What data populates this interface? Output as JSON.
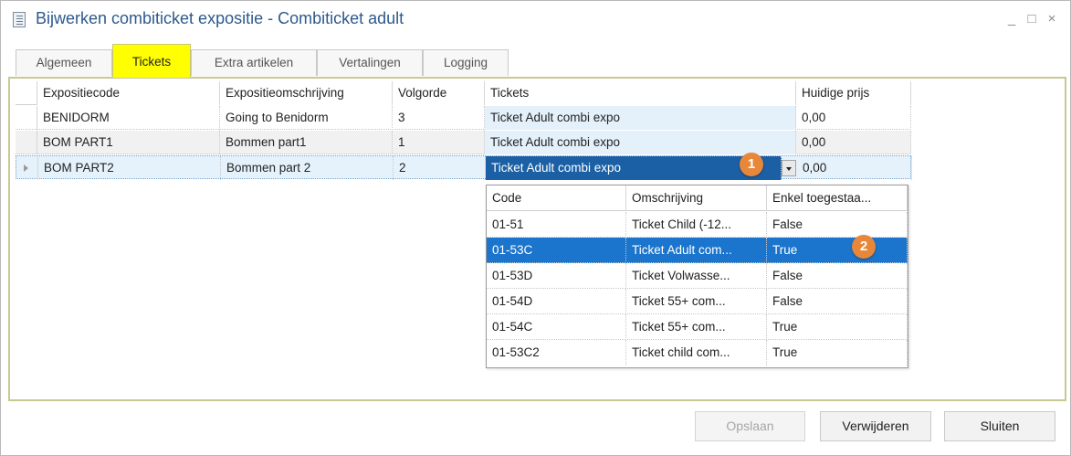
{
  "window": {
    "title": "Bijwerken combiticket expositie  - Combiticket adult",
    "controls": {
      "minimize": "_",
      "maximize": "□",
      "close": "×"
    }
  },
  "tabs": [
    "Algemeen",
    "Tickets",
    "Extra artikelen",
    "Vertalingen",
    "Logging"
  ],
  "active_tab": "Tickets",
  "grid": {
    "headers": [
      "Expositiecode",
      "Expositieomschrijving",
      "Volgorde",
      "Tickets",
      "Huidige prijs"
    ],
    "rows": [
      [
        "BENIDORM",
        "Going to Benidorm",
        "3",
        "Ticket Adult combi expo",
        "0,00"
      ],
      [
        "BOM PART1",
        "Bommen part1",
        "1",
        "Ticket Adult combi expo",
        "0,00"
      ],
      [
        "BOM PART2",
        "Bommen part 2",
        "2",
        "Ticket Adult combi expo",
        "0,00"
      ]
    ]
  },
  "dropdown": {
    "headers": [
      "Code",
      "Omschrijving",
      "Enkel toegestaa..."
    ],
    "rows": [
      [
        "01-51",
        "Ticket Child (-12...",
        "False"
      ],
      [
        "01-53C",
        "Ticket Adult com...",
        "True"
      ],
      [
        "01-53D",
        "Ticket Volwasse...",
        "False"
      ],
      [
        "01-54D",
        "Ticket 55+ com...",
        "False"
      ],
      [
        "01-54C",
        "Ticket 55+ com...",
        "True"
      ],
      [
        "01-53C2",
        "Ticket child com...",
        "True"
      ]
    ],
    "selected_row": 1
  },
  "badges": [
    "1",
    "2"
  ],
  "buttons": {
    "save": "Opslaan",
    "delete": "Verwijderen",
    "close": "Sluiten"
  },
  "colors": {
    "active_tab": "#ffff00",
    "selection": "#1c75cc",
    "badge": "#e8873a",
    "title": "#2d5a8c"
  }
}
